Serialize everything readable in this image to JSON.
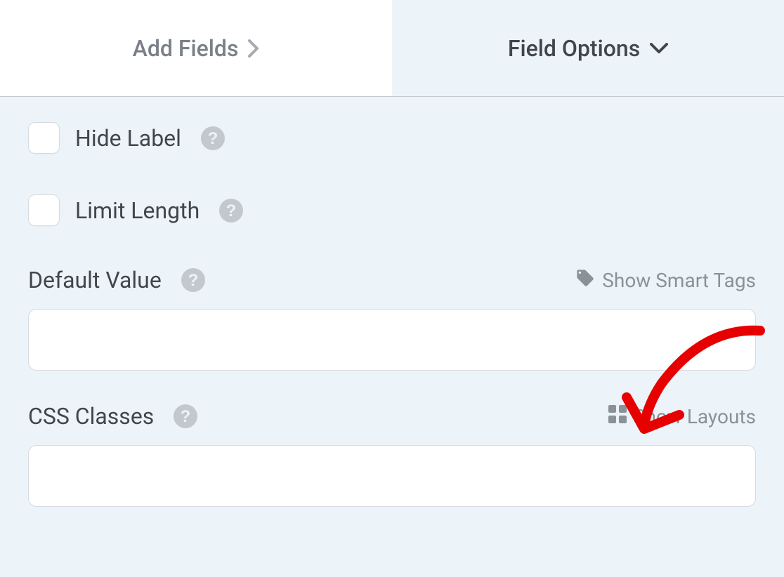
{
  "tabs": {
    "addFields": "Add Fields",
    "fieldOptions": "Field Options"
  },
  "options": {
    "hideLabel": "Hide Label",
    "limitLength": "Limit Length"
  },
  "defaultValue": {
    "label": "Default Value",
    "showSmartTags": "Show Smart Tags",
    "value": ""
  },
  "cssClasses": {
    "label": "CSS Classes",
    "showLayouts": "Show Layouts",
    "value": ""
  }
}
